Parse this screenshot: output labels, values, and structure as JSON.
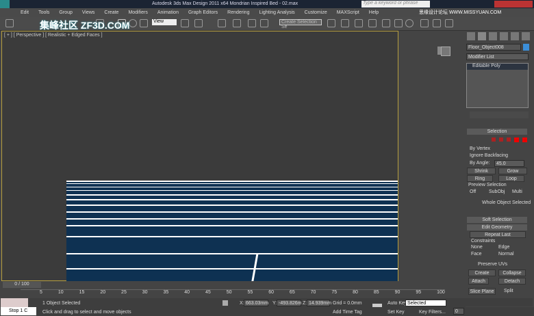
{
  "title": "Autodesk 3ds Max Design 2011 x64    Mondrian Inspired Bed - 02.max",
  "search_placeholder": "Type a keyword or phrase",
  "menu": [
    "Edit",
    "Tools",
    "Group",
    "Views",
    "Create",
    "Modifiers",
    "Animation",
    "Graph Editors",
    "Rendering",
    "Lighting Analysis",
    "Customize",
    "MAXScript",
    "Help"
  ],
  "toolbar": {
    "view_select": "View",
    "selection_set": "Create Selection Se"
  },
  "watermark": {
    "left": "集峰社区 ZF3D.COM",
    "right": "思缘设计论坛 WWW.MISSYUAN.COM"
  },
  "viewport": {
    "label": "[ + ] [ Perspective ] [ Realistic + Edged Faces ]"
  },
  "command_panel": {
    "object_name": "Floor_Object008",
    "modifier_list": "Modifier List",
    "stack_item": "Editable Poly",
    "selection": {
      "title": "Selection",
      "by_vertex": "By Vertex",
      "ignore_backfacing": "Ignore Backfacing",
      "by_angle": "By Angle:",
      "angle_value": "45.0",
      "shrink": "Shrink",
      "grow": "Grow",
      "ring": "Ring",
      "loop": "Loop",
      "preview_title": "Preview Selection",
      "off": "Off",
      "subobj": "SubObj",
      "multi": "Multi",
      "status": "Whole Object Selected"
    },
    "soft_selection": "Soft Selection",
    "edit_geometry": {
      "title": "Edit Geometry",
      "repeat_last": "Repeat Last",
      "constraints": "Constraints",
      "none": "None",
      "edge": "Edge",
      "face": "Face",
      "normal": "Normal",
      "preserve_uvs": "Preserve UVs",
      "create": "Create",
      "collapse": "Collapse",
      "attach": "Attach",
      "detach": "Detach",
      "slice_plane": "Slice Plane",
      "split": "Split"
    }
  },
  "timeline": {
    "frame": "0 / 100",
    "ticks": [
      "5",
      "10",
      "15",
      "20",
      "25",
      "30",
      "35",
      "40",
      "45",
      "50",
      "55",
      "60",
      "65",
      "70",
      "75",
      "80",
      "85",
      "90",
      "95",
      "100"
    ]
  },
  "status": {
    "selected": "1 Object Selected",
    "prompt": "Click and drag to select and move objects",
    "x": "663.03mm",
    "y": "-493.826m",
    "z": "14.939mm",
    "grid": "Grid = 0.0mm",
    "add_time_tag": "Add Time Tag",
    "auto_key": "Auto Key",
    "set_key": "Set Key",
    "key_mode": "Selected",
    "key_filters": "Key Filters...",
    "stop": "Stop",
    "stop_val": "1 C",
    "frame_field": "0",
    "x_label": "X:",
    "y_label": "Y:",
    "z_label": "Z:"
  }
}
